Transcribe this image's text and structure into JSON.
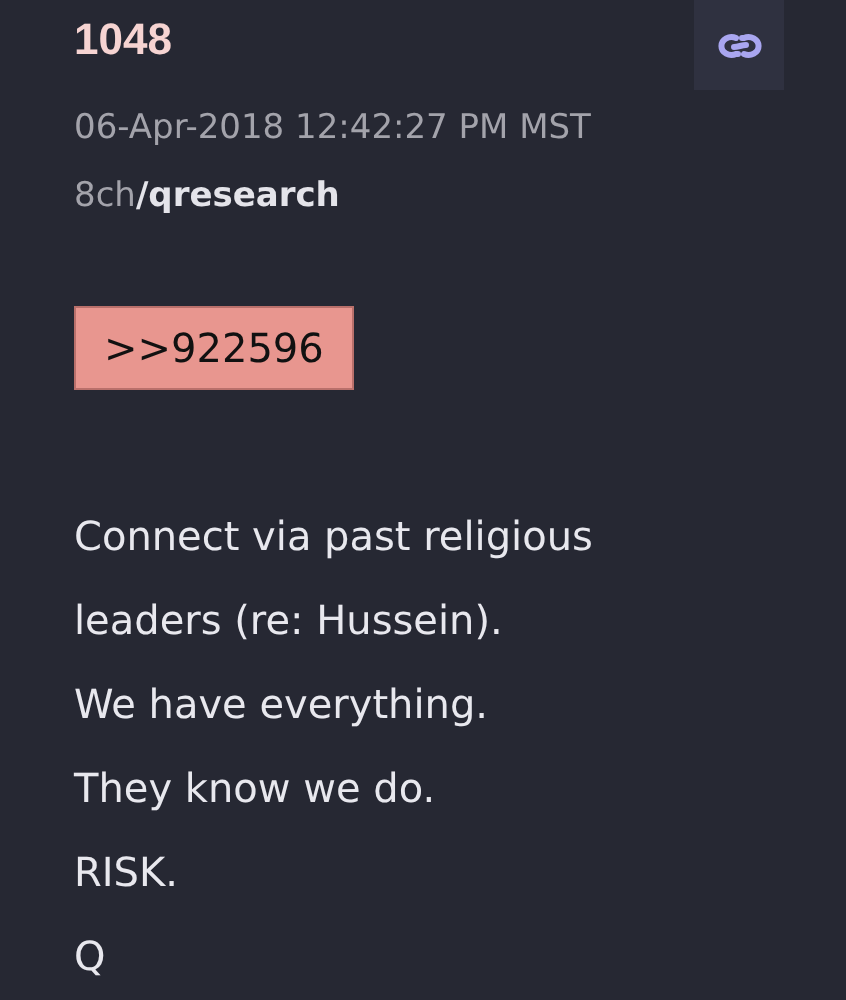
{
  "post": {
    "number": "1048",
    "timestamp": "06-Apr-2018 12:42:27 PM MST",
    "source": "8ch**/qresearch**",
    "reference": ">>922596",
    "lines": [
      "Connect via past religious leaders (re: Hussein).",
      "We have everything.",
      "They know we do.",
      "RISK.",
      "Q"
    ]
  }
}
